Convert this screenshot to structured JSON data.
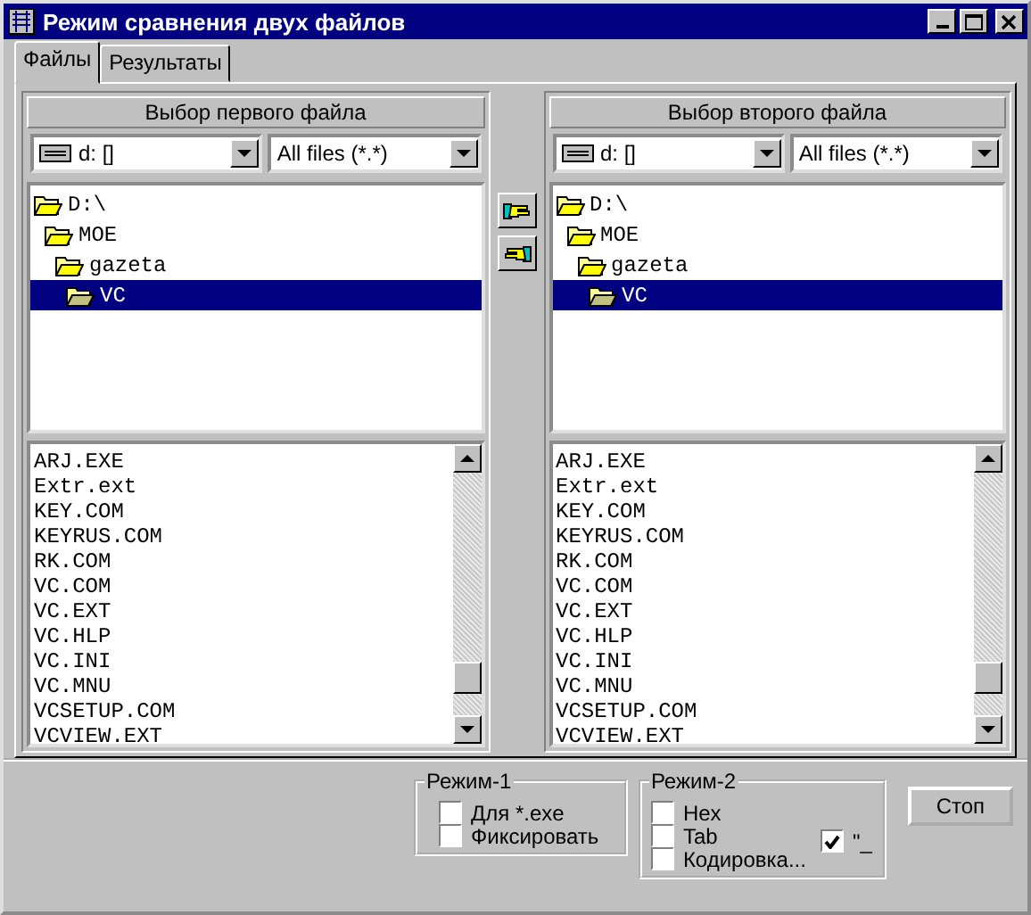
{
  "window": {
    "title": "Режим сравнения двух файлов"
  },
  "tabs": [
    {
      "label": "Файлы",
      "selected": true
    },
    {
      "label": "Результаты",
      "selected": false
    }
  ],
  "panels": [
    {
      "heading": "Выбор первого файла",
      "drive": "d: []",
      "filter": "All files (*.*)",
      "folders": [
        {
          "label": "D:\\",
          "selected": false,
          "children": [
            {
              "label": "MOE",
              "selected": false,
              "children": [
                {
                  "label": "gazeta",
                  "selected": false,
                  "children": [
                    {
                      "label": "VC",
                      "selected": true
                    }
                  ]
                }
              ]
            }
          ]
        }
      ],
      "files": [
        "ARJ.EXE",
        "Extr.ext",
        "KEY.COM",
        "KEYRUS.COM",
        "RK.COM",
        "VC.COM",
        "VC.EXT",
        "VC.HLP",
        "VC.INI",
        "VC.MNU",
        "VCSETUP.COM",
        "VCVIEW.EXT"
      ]
    },
    {
      "heading": "Выбор второго файла",
      "drive": "d: []",
      "filter": "All files (*.*)",
      "folders": [
        {
          "label": "D:\\",
          "selected": false,
          "children": [
            {
              "label": "MOE",
              "selected": false,
              "children": [
                {
                  "label": "gazeta",
                  "selected": false,
                  "children": [
                    {
                      "label": "VC",
                      "selected": true
                    }
                  ]
                }
              ]
            }
          ]
        }
      ],
      "files": [
        "ARJ.EXE",
        "Extr.ext",
        "KEY.COM",
        "KEYRUS.COM",
        "RK.COM",
        "VC.COM",
        "VC.EXT",
        "VC.HLP",
        "VC.INI",
        "VC.MNU",
        "VCSETUP.COM",
        "VCVIEW.EXT"
      ]
    }
  ],
  "mode_1": {
    "title": "Режим-1",
    "options": [
      {
        "label": "Для *.exe",
        "checked": false
      },
      {
        "label": "Фиксировать",
        "checked": false
      }
    ]
  },
  "mode_2": {
    "title": "Режим-2",
    "options": [
      {
        "label": "Hex",
        "checked": false
      },
      {
        "label": "Tab",
        "checked": false
      },
      {
        "label": "Кодировка...",
        "checked": false
      }
    ],
    "extra_option": {
      "label": "\"_",
      "checked": true
    }
  },
  "stop_button": "Стоп"
}
